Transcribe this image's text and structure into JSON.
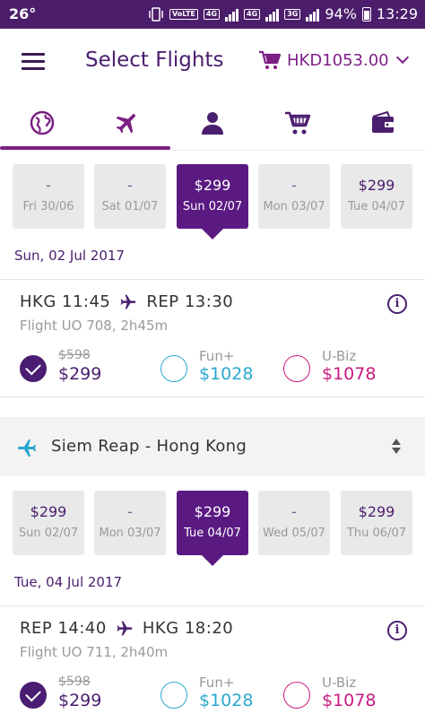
{
  "status_bar": {
    "temperature": "26°",
    "volte": "VoLTE",
    "net1": "4G",
    "net2": "4G",
    "net3": "3G",
    "battery": "94%",
    "time": "13:29"
  },
  "header": {
    "title": "Select Flights",
    "cart_total": "HKD1053.00"
  },
  "tabs": [
    {
      "icon": "globe-icon"
    },
    {
      "icon": "plane-icon",
      "active": true
    },
    {
      "icon": "person-icon"
    },
    {
      "icon": "cart-icon"
    },
    {
      "icon": "wallet-icon"
    }
  ],
  "outbound": {
    "dates": [
      {
        "price": "-",
        "day": "Fri 30/06"
      },
      {
        "price": "-",
        "day": "Sat 01/07"
      },
      {
        "price": "$299",
        "day": "Sun 02/07",
        "selected": true
      },
      {
        "price": "-",
        "day": "Mon 03/07"
      },
      {
        "price": "$299",
        "day": "Tue 04/07"
      }
    ],
    "day_label": "Sun, 02 Jul 2017",
    "flight": {
      "from": "HKG 11:45",
      "to": "REP 13:30",
      "number": "Flight UO  708, 2h45m",
      "fares": {
        "standard": {
          "old": "$598",
          "price": "$299"
        },
        "fun": {
          "label": "Fun+",
          "price": "$1028"
        },
        "ubiz": {
          "label": "U-Biz",
          "price": "$1078"
        }
      }
    }
  },
  "return_segment": {
    "title": "Siem Reap - Hong Kong"
  },
  "inbound": {
    "dates": [
      {
        "price": "$299",
        "day": "Sun 02/07"
      },
      {
        "price": "-",
        "day": "Mon 03/07"
      },
      {
        "price": "$299",
        "day": "Tue 04/07",
        "selected": true
      },
      {
        "price": "-",
        "day": "Wed 05/07"
      },
      {
        "price": "$299",
        "day": "Thu 06/07"
      }
    ],
    "day_label": "Tue, 04 Jul 2017",
    "flight": {
      "from": "REP 14:40",
      "to": "HKG 18:20",
      "number": "Flight UO  711, 2h40m",
      "fares": {
        "standard": {
          "old": "$598",
          "price": "$299"
        },
        "fun": {
          "label": "Fun+",
          "price": "$1028"
        },
        "ubiz": {
          "label": "U-Biz",
          "price": "$1078"
        }
      }
    }
  },
  "colors": {
    "brand_purple": "#4a1e6e",
    "accent_magenta": "#7a2082",
    "fun_blue": "#2aa7cf",
    "ubiz_pink": "#c91a80",
    "status_bar": "#4b1d6b"
  }
}
